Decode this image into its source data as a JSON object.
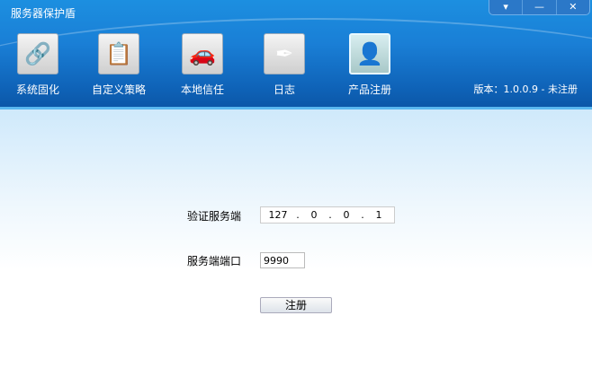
{
  "window": {
    "title": "服务器保护盾",
    "buttons": [
      "▾",
      "—",
      "✕"
    ]
  },
  "toolbar": [
    {
      "label": "系统固化",
      "icon": "drive-chain-icon",
      "glyph": "🔗"
    },
    {
      "label": "自定义策略",
      "icon": "policy-add-icon",
      "glyph": "📋"
    },
    {
      "label": "本地信任",
      "icon": "car-add-icon",
      "glyph": "🚗"
    },
    {
      "label": "日志",
      "icon": "log-pen-icon",
      "glyph": "✒"
    },
    {
      "label": "产品注册",
      "icon": "register-user-icon",
      "glyph": "👤"
    }
  ],
  "version": "版本：1.0.0.9 - 未注册",
  "form": {
    "server_label": "验证服务端",
    "ip": [
      "127",
      ".",
      "0",
      ".",
      "0",
      ".",
      "1"
    ],
    "port_label": "服务端端口",
    "port": "9990",
    "register_button": "注册"
  }
}
